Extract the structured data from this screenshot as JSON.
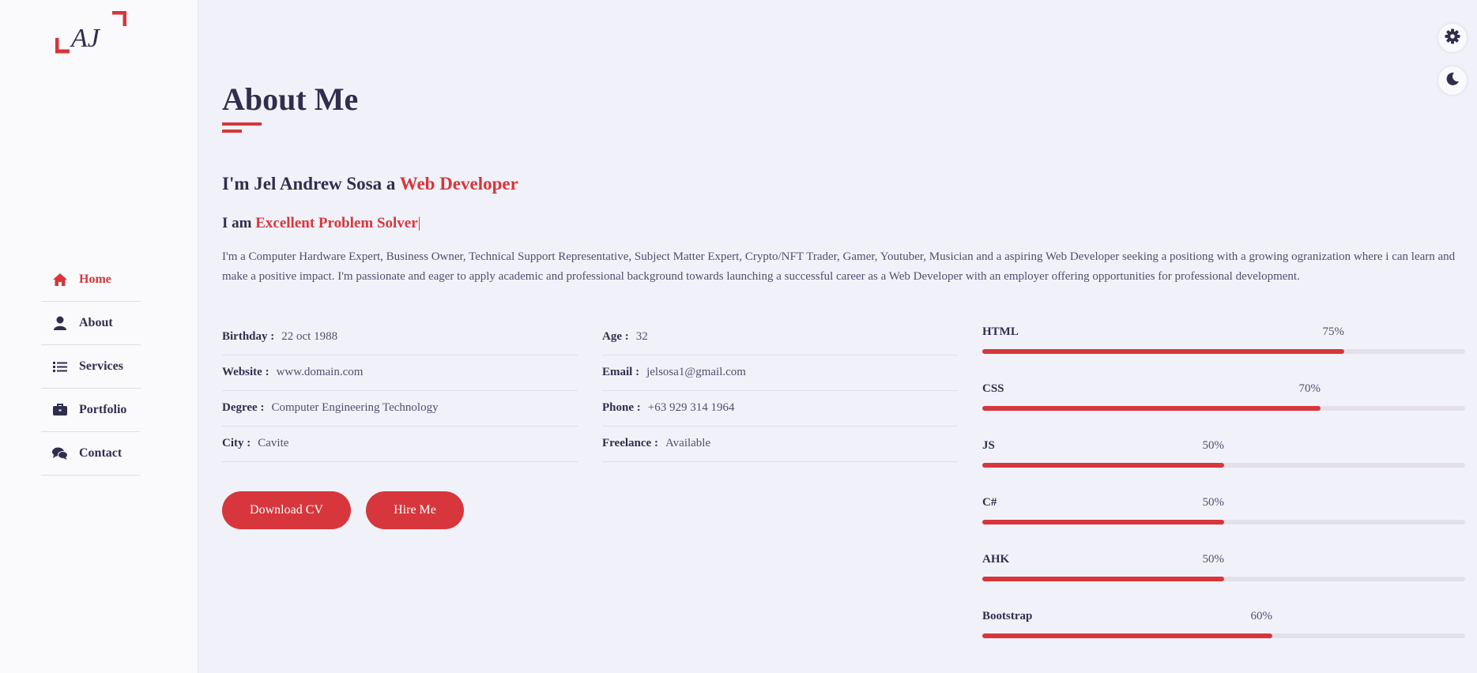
{
  "logo": {
    "text": "AJ",
    "accent": "#d6363c"
  },
  "nav": [
    {
      "label": "Home",
      "icon": "home-icon",
      "active": true
    },
    {
      "label": "About",
      "icon": "user-icon",
      "active": false
    },
    {
      "label": "Services",
      "icon": "list-icon",
      "active": false
    },
    {
      "label": "Portfolio",
      "icon": "briefcase-icon",
      "active": false
    },
    {
      "label": "Contact",
      "icon": "comments-icon",
      "active": false
    }
  ],
  "header": {
    "title": "About Me"
  },
  "intro": {
    "prefix": "I'm Jel Andrew Sosa a ",
    "role": "Web Developer"
  },
  "typing": {
    "prefix": "I am ",
    "text": "Excellent Problem Solver",
    "caret": "|"
  },
  "description": "I'm a Computer Hardware Expert, Business Owner, Technical Support Representative, Subject Matter Expert, Crypto/NFT Trader, Gamer, Youtuber, Musician and a aspiring Web Developer seeking a positiong with a growing ogranization where i can learn and make a positive impact. I'm passionate and eager to apply academic and professional background towards launching a successful career as a Web Developer with an employer offering opportunities for professional development.",
  "info_left": [
    {
      "key": "Birthday :",
      "value": "22 oct 1988"
    },
    {
      "key": "Website :",
      "value": "www.domain.com"
    },
    {
      "key": "Degree :",
      "value": "Computer Engineering Technology"
    },
    {
      "key": "City :",
      "value": "Cavite"
    }
  ],
  "info_right": [
    {
      "key": "Age :",
      "value": "32"
    },
    {
      "key": "Email :",
      "value": "jelsosa1@gmail.com"
    },
    {
      "key": "Phone :",
      "value": "+63 929 314 1964"
    },
    {
      "key": "Freelance :",
      "value": "Available"
    }
  ],
  "buttons": {
    "download": "Download CV",
    "hire": "Hire Me"
  },
  "skills": [
    {
      "name": "HTML",
      "percent": 75,
      "label": "75%"
    },
    {
      "name": "CSS",
      "percent": 70,
      "label": "70%"
    },
    {
      "name": "JS",
      "percent": 50,
      "label": "50%"
    },
    {
      "name": "C#",
      "percent": 50,
      "label": "50%"
    },
    {
      "name": "AHK",
      "percent": 50,
      "label": "50%"
    },
    {
      "name": "Bootstrap",
      "percent": 60,
      "label": "60%"
    }
  ],
  "colors": {
    "accent": "#d6363c",
    "text": "#302e4d",
    "background": "#f1f2f9"
  },
  "top_buttons": [
    "gear-icon",
    "moon-icon"
  ]
}
